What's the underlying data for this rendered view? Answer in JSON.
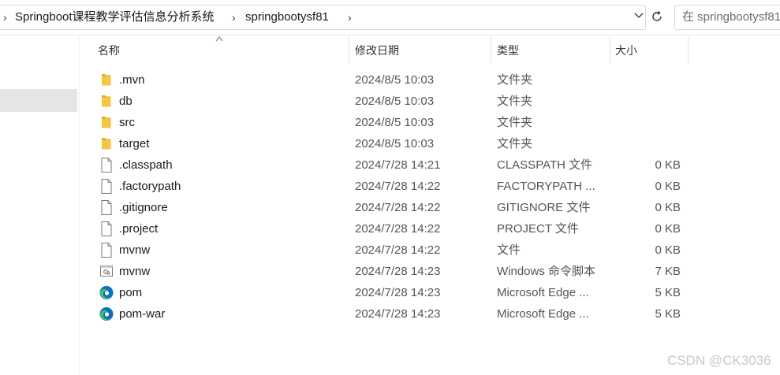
{
  "address": {
    "crumbs": [
      "Springboot课程教学评估信息分析系统",
      "springbootysf81"
    ],
    "search_placeholder": "在 springbootysf81"
  },
  "columns": {
    "name": "名称",
    "date": "修改日期",
    "type": "类型",
    "size": "大小"
  },
  "files": [
    {
      "name": ".mvn",
      "date": "2024/8/5 10:03",
      "type": "文件夹",
      "size": "",
      "icon": "folder-icon"
    },
    {
      "name": "db",
      "date": "2024/8/5 10:03",
      "type": "文件夹",
      "size": "",
      "icon": "folder-icon"
    },
    {
      "name": "src",
      "date": "2024/8/5 10:03",
      "type": "文件夹",
      "size": "",
      "icon": "folder-icon"
    },
    {
      "name": "target",
      "date": "2024/8/5 10:03",
      "type": "文件夹",
      "size": "",
      "icon": "folder-icon"
    },
    {
      "name": ".classpath",
      "date": "2024/7/28 14:21",
      "type": "CLASSPATH 文件",
      "size": "0 KB",
      "icon": "file-icon"
    },
    {
      "name": ".factorypath",
      "date": "2024/7/28 14:22",
      "type": "FACTORYPATH ...",
      "size": "0 KB",
      "icon": "file-icon"
    },
    {
      "name": ".gitignore",
      "date": "2024/7/28 14:22",
      "type": "GITIGNORE 文件",
      "size": "0 KB",
      "icon": "file-icon"
    },
    {
      "name": ".project",
      "date": "2024/7/28 14:22",
      "type": "PROJECT 文件",
      "size": "0 KB",
      "icon": "file-icon"
    },
    {
      "name": "mvnw",
      "date": "2024/7/28 14:22",
      "type": "文件",
      "size": "0 KB",
      "icon": "file-icon"
    },
    {
      "name": "mvnw",
      "date": "2024/7/28 14:23",
      "type": "Windows 命令脚本",
      "size": "7 KB",
      "icon": "script-file-icon"
    },
    {
      "name": "pom",
      "date": "2024/7/28 14:23",
      "type": "Microsoft Edge ...",
      "size": "5 KB",
      "icon": "edge-icon"
    },
    {
      "name": "pom-war",
      "date": "2024/7/28 14:23",
      "type": "Microsoft Edge ...",
      "size": "5 KB",
      "icon": "edge-icon"
    }
  ],
  "watermark": "CSDN @CK3036",
  "colors": {
    "folder": "#f7c443",
    "folder_dark": "#e2a82a",
    "edge_blue": "#0c6fc6",
    "edge_green": "#4cc15c",
    "selection_bg": "#e5e5e5"
  }
}
